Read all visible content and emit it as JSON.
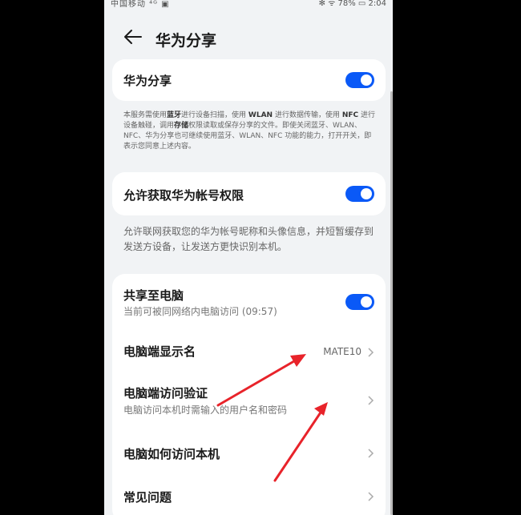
{
  "status": {
    "left": "中国移动 ⁴ᴳ ▣",
    "right": "✻ ᯤ 78% ▭ 2:04"
  },
  "header": {
    "title": "华为分享"
  },
  "share": {
    "label": "华为分享",
    "enabled": true,
    "description_parts": [
      "本服务需使用",
      "蓝牙",
      "进行设备扫描，使用 ",
      "WLAN",
      " 进行数据传输，使用 ",
      "NFC",
      " 进行设备触碰，调用",
      "存储",
      "权限读取或保存分享的文件。即使关闭蓝牙、WLAN、NFC、华为分享也可继续使用蓝牙、WLAN、NFC 功能的能力，打开开关，即表示您同意上述内容。"
    ]
  },
  "account": {
    "label": "允许获取华为帐号权限",
    "enabled": true,
    "description": "允许联网获取您的华为帐号昵称和头像信息，并短暂缓存到发送方设备，让发送方更快识别本机。"
  },
  "pc": {
    "share_label": "共享至电脑",
    "share_sub": "当前可被同网络内电脑访问 (09:57)",
    "share_enabled": true,
    "display_name_label": "电脑端显示名",
    "display_name_value": "MATE10",
    "verify_label": "电脑端访问验证",
    "verify_sub": "电脑访问本机时需输入的用户名和密码",
    "howto_label": "电脑如何访问本机",
    "faq_label": "常见问题"
  },
  "colors": {
    "accent": "#0a59f7",
    "annotation": "#e8232a"
  }
}
